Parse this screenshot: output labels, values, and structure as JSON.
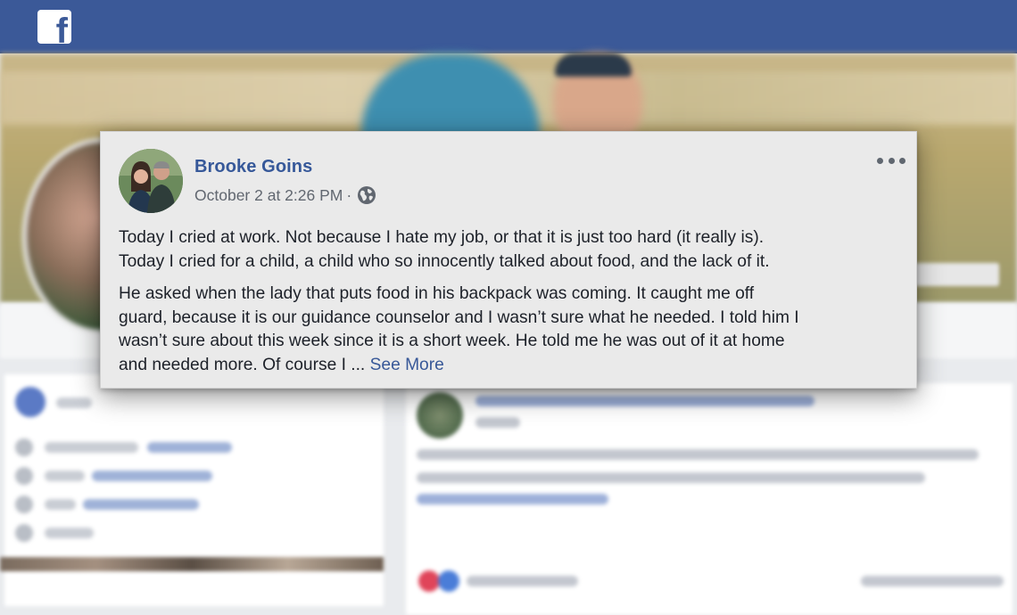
{
  "topbar": {
    "logo_icon": "facebook-logo-icon",
    "brand_color": "#3b5998"
  },
  "post": {
    "author": "Brooke Goins",
    "timestamp": "October 2 at 2:26 PM",
    "separator": "·",
    "privacy_icon": "globe-icon",
    "more_icon": "more-options-icon",
    "paragraph1": [
      "Today I cried at work. Not because I hate my job, or that it is just too hard (it really is).",
      "Today I cried for a child, a child who so innocently talked about food, and the lack of it."
    ],
    "paragraph2": [
      "He asked when the lady that puts food in his backpack was coming. It caught me off",
      "guard, because it is our guidance counselor and I wasn’t sure what he needed. I told him I",
      "wasn’t sure about this week since it is a short week. He told me he was out of it at home",
      "and needed more. Of course I ..."
    ],
    "see_more": "See More",
    "link_color": "#385898"
  }
}
